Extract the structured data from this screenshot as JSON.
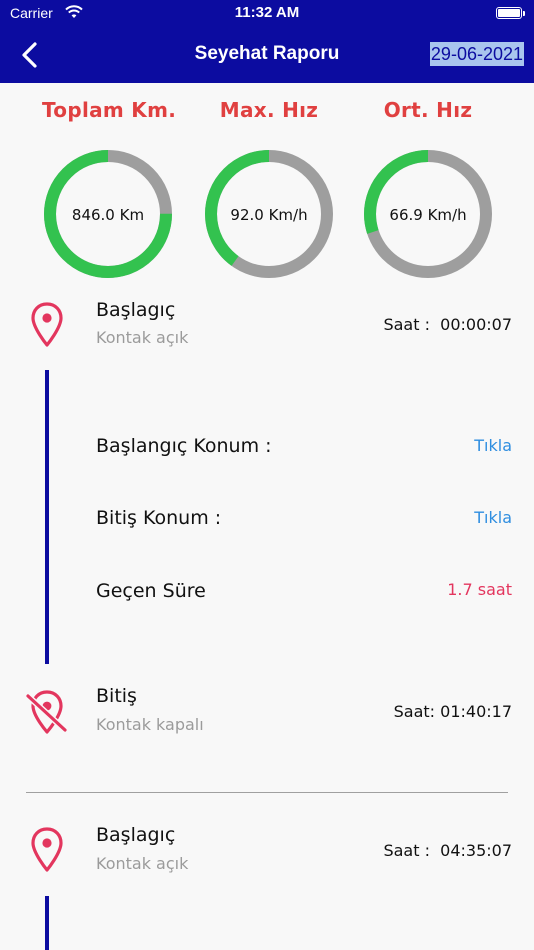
{
  "status_bar": {
    "carrier": "Carrier",
    "time": "11:32 AM"
  },
  "nav": {
    "title": "Seyehat Raporu",
    "date": "29-06-2021"
  },
  "colors": {
    "primary": "#0c0ca0",
    "gauge_fill": "#33c24f",
    "gauge_track": "#9e9e9e",
    "label_red": "#e04040",
    "link_blue": "#2f8ee0",
    "pink": "#e3365e"
  },
  "gauges": [
    {
      "label": "Toplam Km.",
      "value": "846.0 Km",
      "fill_fraction": 0.75
    },
    {
      "label": "Max. Hız",
      "value": "92.0 Km/h",
      "fill_fraction": 0.4
    },
    {
      "label": "Ort. Hız",
      "value": "66.9 Km/h",
      "fill_fraction": 0.3
    }
  ],
  "trip1": {
    "start": {
      "title": "Başlagıç",
      "subtitle": "Kontak açık",
      "time": "Saat :  00:00:07"
    },
    "rows": [
      {
        "label": "Başlangıç Konum :",
        "value": "Tıkla"
      },
      {
        "label": "Bitiş Konum :",
        "value": "Tıkla"
      },
      {
        "label": "Geçen Süre",
        "value": "1.7 saat"
      }
    ],
    "end": {
      "title": "Bitiş",
      "subtitle": "Kontak kapalı",
      "time": "Saat: 01:40:17"
    }
  },
  "trip2": {
    "start": {
      "title": "Başlagıç",
      "subtitle": "Kontak açık",
      "time": "Saat :  04:35:07"
    }
  }
}
